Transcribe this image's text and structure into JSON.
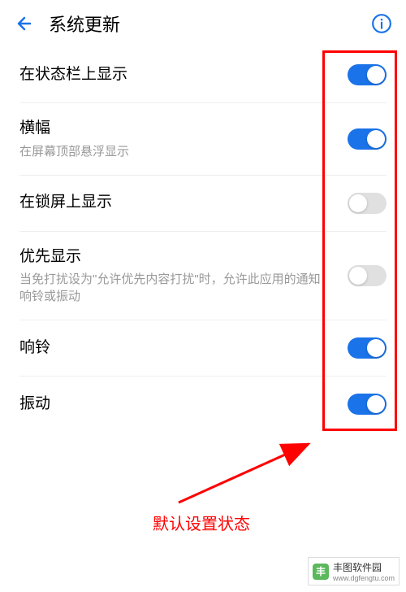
{
  "header": {
    "title": "系统更新"
  },
  "settings": [
    {
      "label": "在状态栏上显示",
      "desc": "",
      "enabled": true
    },
    {
      "label": "横幅",
      "desc": "在屏幕顶部悬浮显示",
      "enabled": true
    },
    {
      "label": "在锁屏上显示",
      "desc": "",
      "enabled": false
    },
    {
      "label": "优先显示",
      "desc": "当免打扰设为\"允许优先内容打扰\"时，允许此应用的通知响铃或振动",
      "enabled": false
    },
    {
      "label": "响铃",
      "desc": "",
      "enabled": true
    },
    {
      "label": "振动",
      "desc": "",
      "enabled": true
    }
  ],
  "annotation": {
    "text": "默认设置状态"
  },
  "watermark": {
    "title": "丰图软件园",
    "url": "www.dgfengtu.com"
  }
}
